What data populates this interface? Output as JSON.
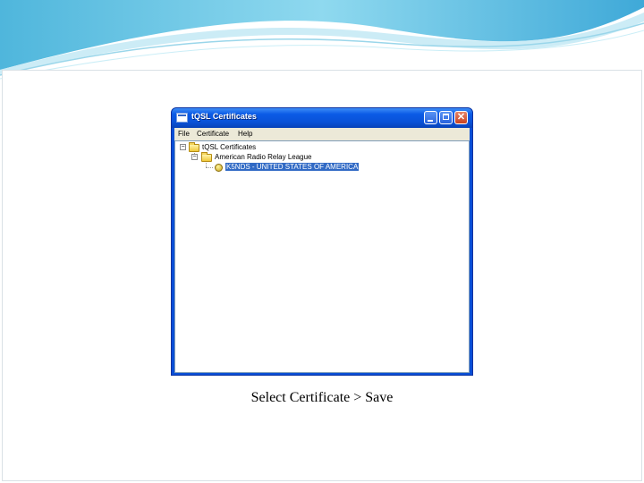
{
  "window": {
    "title": "tQSL Certificates",
    "menu": [
      "File",
      "Certificate",
      "Help"
    ],
    "controls": {
      "minimize": "minimize",
      "maximize": "maximize",
      "close": "✕"
    }
  },
  "tree": {
    "root_label": "tQSL Certificates",
    "org_label": "American Radio Relay League",
    "cert_label": "K5NDS - UNITED STATES OF AMERICA",
    "collapse_glyph": "−"
  },
  "caption": "Select Certificate > Save",
  "colors": {
    "titlebar": "#0a52d8",
    "selection": "#316ac5",
    "header_wave": "#5bc4e4"
  },
  "icons": [
    "app-icon",
    "folder-icon",
    "certificate-icon"
  ]
}
